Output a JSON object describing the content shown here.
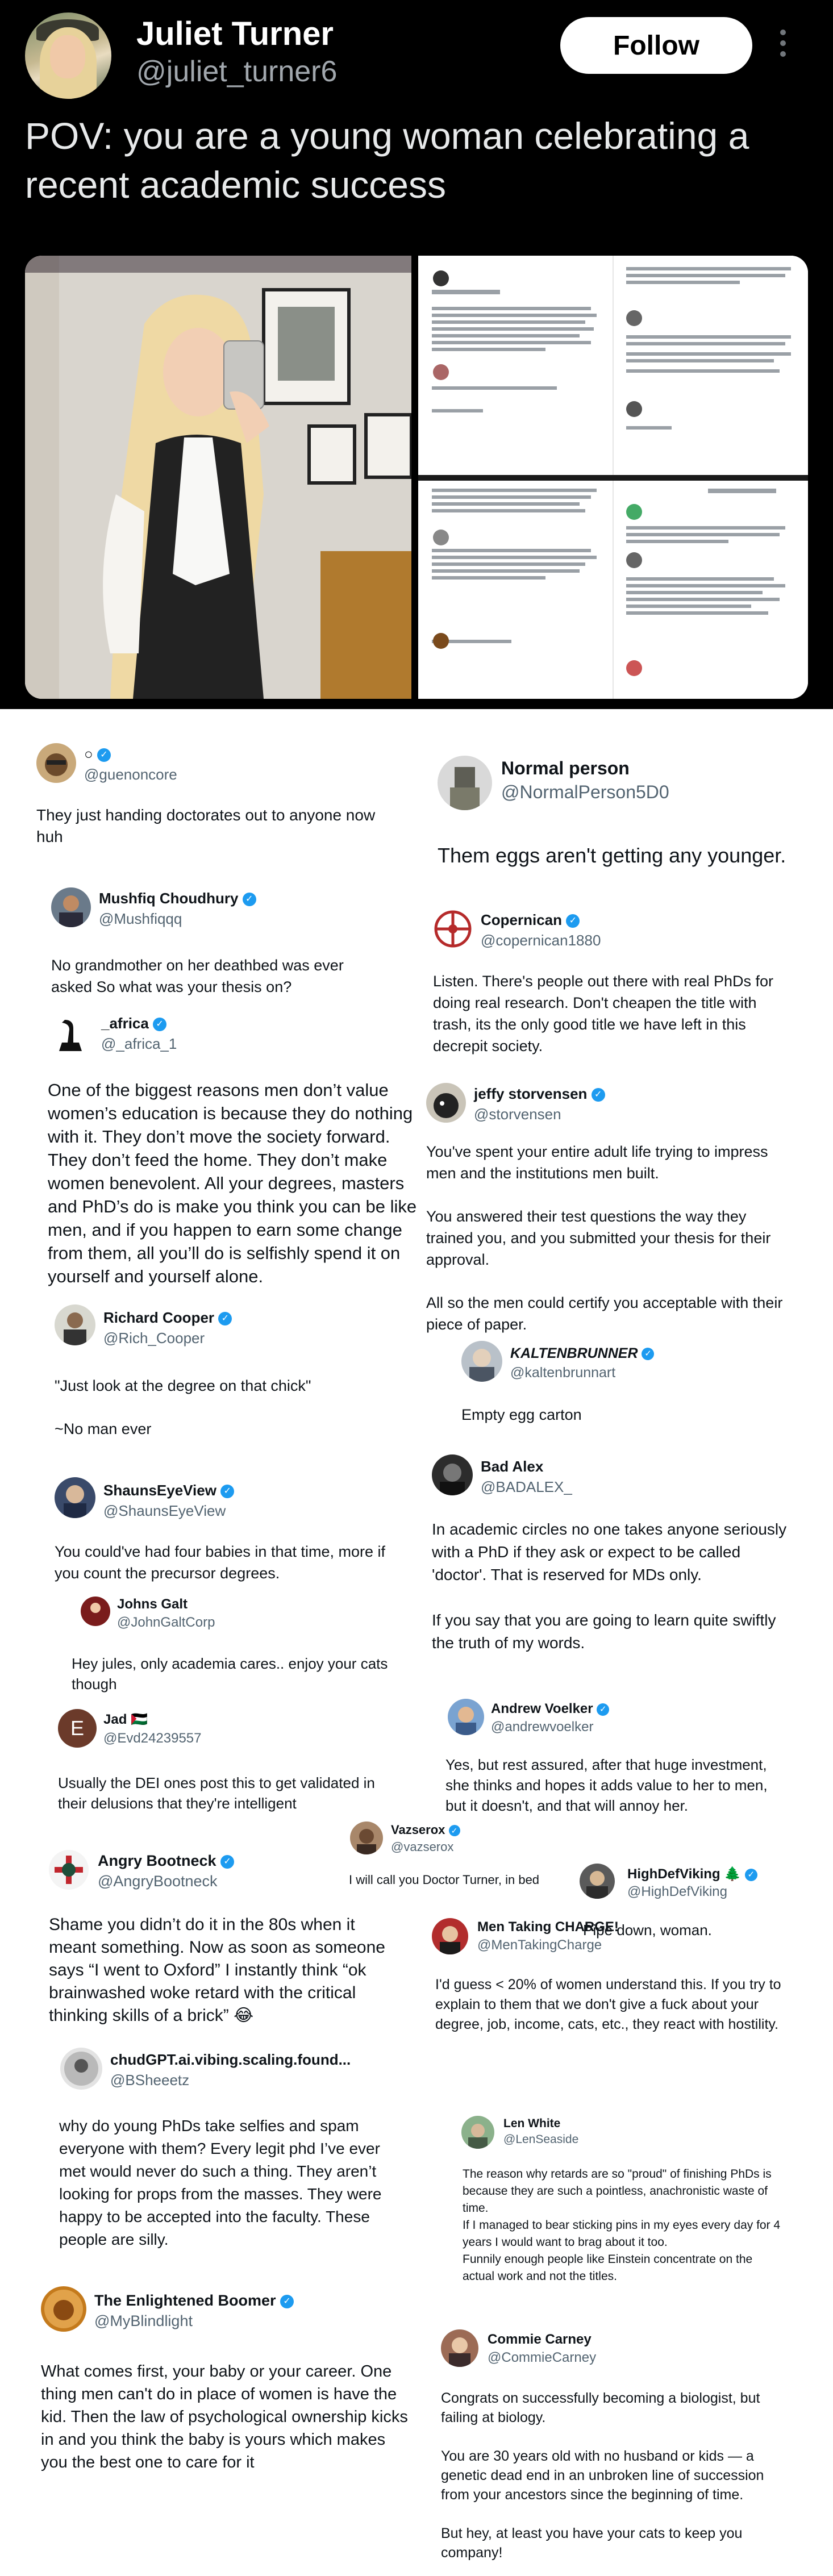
{
  "header": {
    "display_name": "Juliet Turner",
    "handle": "@juliet_turner6",
    "follow_label": "Follow",
    "tweet_text": "POV: you are a young woman celebrating a recent academic success"
  },
  "screenshot_preview": {
    "line1": "So what was your thesis on?",
    "line2": "Listen. There's people out there with real PhDs for doing real research.",
    "line3": "Shame you didn't do it in the 80s when it meant something.",
    "line4": "Pipe down, woman.",
    "line5": "Empty egg carton",
    "line6": "\"Just look at the degree on that chick\""
  },
  "replies": [
    {
      "name": "○",
      "handle": "@guenoncore",
      "text": "They just handing doctorates out to anyone now huh"
    },
    {
      "name": "Normal person",
      "handle": "@NormalPerson5D0",
      "text": "Them eggs aren't getting any younger."
    },
    {
      "name": "Mushfiq Choudhury",
      "handle": "@Mushfiqqq",
      "text": "No grandmother on her deathbed was ever asked So what was your thesis on?"
    },
    {
      "name": "Copernican",
      "handle": "@copernican1880",
      "text": "Listen. There's people out there with real PhDs for doing real research. Don't cheapen the title with trash, its the only good title we have left in this decrepit society."
    },
    {
      "name": "_africa",
      "handle": "@_africa_1",
      "text": "One of the biggest reasons men don’t value women’s education is because they do nothing with it. They don’t move the society forward. They don’t feed the home. They don’t make women benevolent. All your degrees, masters and PhD’s do is make you think you can be like men, and if you happen to earn some change from them, all you’ll do is selfishly spend it on yourself and yourself alone."
    },
    {
      "name": "jeffy storvensen",
      "handle": "@storvensen",
      "text": "You've spent your entire adult life trying to impress men and the institutions men built.",
      "text2": "You answered their test questions the way they trained you, and you submitted your thesis for their approval.",
      "text3": "All so the men could certify you acceptable with their piece of paper."
    },
    {
      "name": "Richard Cooper",
      "handle": "@Rich_Cooper",
      "text": "\"Just look at the degree on that chick\"",
      "text2": "~No man ever"
    },
    {
      "name": "KALTENBRUNNER",
      "handle": "@kaltenbrunnart",
      "text": "Empty egg carton"
    },
    {
      "name": "ShaunsEyeView",
      "handle": "@ShaunsEyeView",
      "text": "You could've had four babies in that time, more if you count the precursor degrees."
    },
    {
      "name": "Bad Alex",
      "handle": "@BADALEX_",
      "text": "In academic circles no one takes anyone seriously with a PhD if they ask or expect to be called 'doctor'. That is reserved for MDs only.",
      "text2": "If you say that you are going to learn quite swiftly the truth of my words."
    },
    {
      "name": "Johns Galt",
      "handle": "@JohnGaltCorp",
      "text": "Hey jules, only academia cares.. enjoy your cats though"
    },
    {
      "name": "Jad 🇵🇸",
      "handle": "@Evd24239557",
      "text": "Usually the DEI ones post this to get validated in their delusions that they're intelligent"
    },
    {
      "name": "Andrew Voelker",
      "handle": "@andrewvoelker",
      "text": "Yes, but rest assured, after that huge investment, she thinks and hopes it adds value to her to men, but it doesn't, and that will annoy her."
    },
    {
      "name": "Vazserox",
      "handle": "@vazserox",
      "text": "I will call you Doctor Turner, in bed"
    },
    {
      "name": "Angry Bootneck",
      "handle": "@AngryBootneck",
      "text": "Shame you didn’t do it in the 80s when it meant something. Now as soon as someone says “I went to Oxford” I instantly think “ok brainwashed woke retard with the critical thinking skills of a brick” 😂"
    },
    {
      "name": "HighDefViking 🌲",
      "handle": "@HighDefViking",
      "text": "Pipe down, woman."
    },
    {
      "name": "Men Taking CHARGE!",
      "handle": "@MenTakingCharge",
      "text": "I'd guess < 20% of women understand this. If you try to explain to them that we don't give a fuck about your degree, job, income, cats, etc., they react with hostility."
    },
    {
      "name": "chudGPT.ai.vibing.scaling.found...",
      "handle": "@BSheeetz",
      "text": "why do young PhDs take selfies and spam everyone with them? Every legit phd I’ve ever met would never do such a thing. They aren’t looking for props from the masses. They were happy to be accepted into the faculty. These people are silly."
    },
    {
      "name": "Len White",
      "handle": "@LenSeaside",
      "text": "The reason why retards are so \"proud\" of finishing PhDs is because they are such a pointless, anachronistic waste of time.",
      "text2": "If I managed to bear sticking pins in my eyes every day for 4 years I would want to brag about it too.",
      "text3": "Funnily enough people like Einstein concentrate on the actual work and not the titles."
    },
    {
      "name": "The Enlightened Boomer",
      "handle": "@MyBlindlight",
      "text": "What comes first, your baby or your career. One thing men can't do in place of women is have the kid. Then the law of psychological ownership kicks in and you think the baby is yours which makes you the best one to care for it"
    },
    {
      "name": "Commie Carney",
      "handle": "@CommieCarney",
      "text": "Congrats on successfully becoming a biologist, but failing at biology.",
      "text2": "You are 30 years old with no husband or kids — a genetic dead end in an unbroken line of succession from your ancestors since the beginning of time.",
      "text3": "But hey, at least you have your cats to keep you company!"
    }
  ],
  "colors": {
    "accent": "#1d9bf0",
    "dark_bg": "#000000",
    "muted": "#536471"
  },
  "icons": [
    "more-icon",
    "verified-badge-icon"
  ]
}
